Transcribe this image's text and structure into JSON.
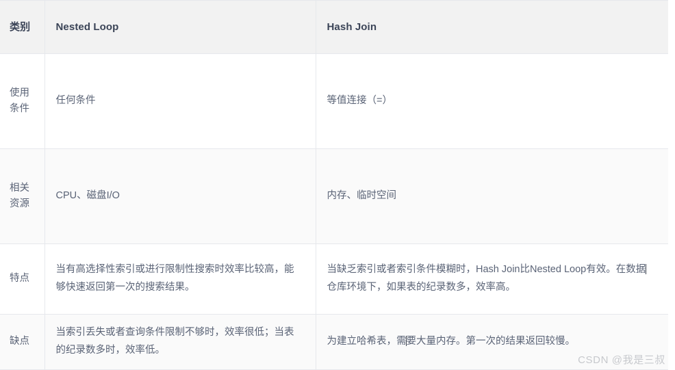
{
  "table": {
    "columns": [
      {
        "key": "category",
        "label": "类别"
      },
      {
        "key": "nested_loop",
        "label": "Nested Loop"
      },
      {
        "key": "hash_join",
        "label": "Hash Join"
      }
    ],
    "rows": [
      {
        "category": "使用条件",
        "nested_loop": "任何条件",
        "hash_join": "等值连接（=）"
      },
      {
        "category": "相关资源",
        "nested_loop": "CPU、磁盘I/O",
        "hash_join": "内存、临时空间"
      },
      {
        "category": "特点",
        "nested_loop": "当有高选择性索引或进行限制性搜索时效率比较高，能够快速返回第一次的搜索结果。",
        "hash_join_part1": "当缺乏索引或者索引条件模糊时，Hash Join比Nested Loop有效。在数据",
        "hash_join_part2": "仓库环境下，如果表的纪录数多，效率高。"
      },
      {
        "category": "缺点",
        "nested_loop": "当索引丢失或者查询条件限制不够时，效率很低；当表的纪录数多时，效率低。",
        "hash_join_part1": "为建立哈希表，需",
        "hash_join_part2": "要大量内存。第一次的结果返回较慢。"
      }
    ]
  },
  "watermark": {
    "text": "CSDN @我是三叔"
  },
  "colors": {
    "header_bg": "#f2f2f2",
    "border": "#e6e8ec",
    "header_text": "#3b4457",
    "body_text": "#5a6376",
    "stripe_bg": "#fafafa",
    "watermark_text": "#c7c9cd"
  }
}
